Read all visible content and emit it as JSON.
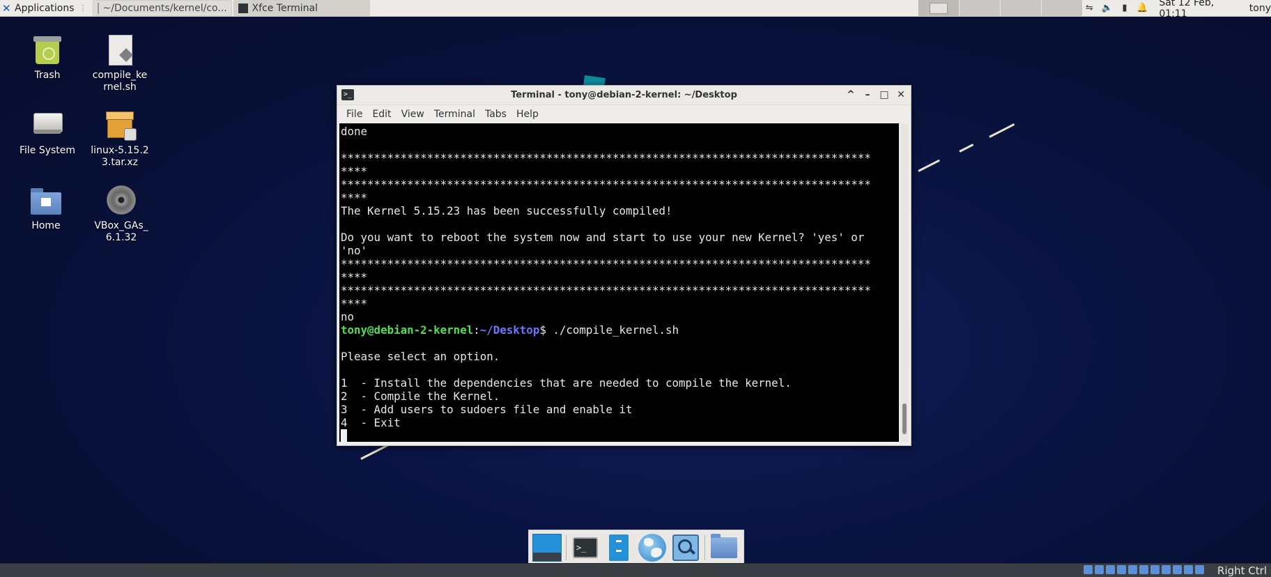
{
  "top_panel": {
    "applications_label": "Applications",
    "windows": [
      {
        "title": "~/Documents/kernel/co...",
        "icon": "text-editor-icon"
      },
      {
        "title": "Xfce Terminal",
        "icon": "terminal-icon"
      }
    ],
    "tray_icons": [
      "network-icon",
      "volume-icon",
      "battery-icon",
      "notification-bell-icon"
    ],
    "clock": "Sat 12 Feb, 01:11",
    "user": "tony"
  },
  "desktop_icons": [
    {
      "label": "Trash",
      "icon": "trash-icon"
    },
    {
      "label": "compile_kernel.sh",
      "icon": "script-file-icon"
    },
    {
      "label": "File System",
      "icon": "drive-icon"
    },
    {
      "label": "linux-5.15.23.tar.xz",
      "icon": "archive-icon"
    },
    {
      "label": "Home",
      "icon": "home-folder-icon"
    },
    {
      "label": "VBox_GAs_6.1.32",
      "icon": "optical-disc-icon"
    }
  ],
  "terminal": {
    "title": "Terminal - tony@debian-2-kernel: ~/Desktop",
    "menu": [
      "File",
      "Edit",
      "View",
      "Terminal",
      "Tabs",
      "Help"
    ],
    "lines": [
      "done",
      "",
      "********************************************************************************",
      "****",
      "********************************************************************************",
      "****",
      "The Kernel 5.15.23 has been successfully compiled!",
      "",
      "Do you want to reboot the system now and start to use your new Kernel? 'yes' or",
      "'no'",
      "********************************************************************************",
      "****",
      "********************************************************************************",
      "****",
      "no"
    ],
    "prompt": {
      "user_host": "tony@debian-2-kernel",
      "sep": ":",
      "path": "~/Desktop",
      "symbol": "$ ",
      "command": "./compile_kernel.sh"
    },
    "after_lines": [
      "",
      "Please select an option.",
      "",
      "1  - Install the dependencies that are needed to compile the kernel.",
      "2  - Compile the Kernel.",
      "3  - Add users to sudoers file and enable it",
      "4  - Exit"
    ]
  },
  "dock": {
    "items": [
      "show-desktop-icon",
      "terminal-icon",
      "file-manager-icon",
      "web-browser-icon",
      "app-finder-icon",
      "folder-icon"
    ]
  },
  "statusbar": {
    "host_key": "Right Ctrl"
  },
  "colors": {
    "desktop_bg": "#0b1440",
    "prompt_user": "#4fe04f",
    "prompt_path": "#6f74ff"
  }
}
